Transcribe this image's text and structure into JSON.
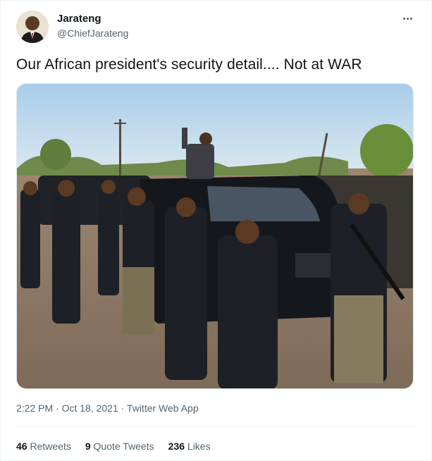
{
  "user": {
    "display_name": "Jarateng",
    "handle": "@ChiefJarateng"
  },
  "tweet": {
    "text": "Our African president's security detail.... Not at WAR",
    "timestamp": "2:22 PM · Oct 18, 2021 · Twitter Web App"
  },
  "stats": {
    "retweets_count": "46",
    "retweets_label": "Retweets",
    "quotes_count": "9",
    "quotes_label": "Quote Tweets",
    "likes_count": "236",
    "likes_label": "Likes"
  },
  "icons": {
    "more": "more-options-icon"
  },
  "colors": {
    "text_primary": "#0f1419",
    "text_secondary": "#536471",
    "border": "#eff3f4"
  }
}
